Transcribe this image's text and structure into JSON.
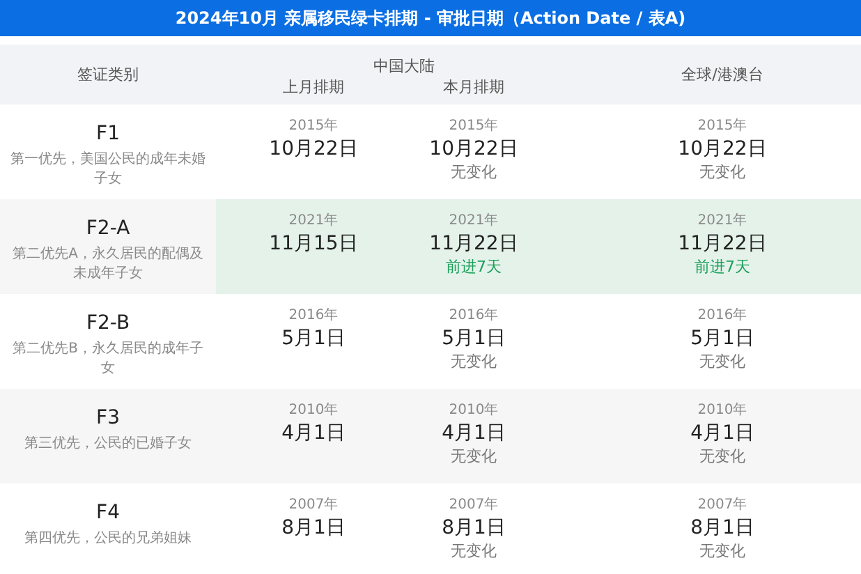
{
  "title": "2024年10月 亲属移民绿卡排期 - 审批日期（Action Date / 表A)",
  "header": {
    "category": "签证类别",
    "group": "中国大陆",
    "last_month": "上月排期",
    "this_month": "本月排期",
    "global": "全球/港澳台"
  },
  "rows": [
    {
      "code": "F1",
      "description": "第一优先，美国公民的成年未婚子女",
      "highlighted": false,
      "last": {
        "year": "2015年",
        "date": "10月22日"
      },
      "this": {
        "year": "2015年",
        "date": "10月22日",
        "change": {
          "text": "无变化",
          "kind": "none"
        }
      },
      "global": {
        "year": "2015年",
        "date": "10月22日",
        "change": {
          "text": "无变化",
          "kind": "none"
        }
      }
    },
    {
      "code": "F2-A",
      "description": "第二优先A，永久居民的配偶及未成年子女",
      "highlighted": true,
      "last": {
        "year": "2021年",
        "date": "11月15日"
      },
      "this": {
        "year": "2021年",
        "date": "11月22日",
        "change": {
          "text": "前进7天",
          "kind": "advance"
        }
      },
      "global": {
        "year": "2021年",
        "date": "11月22日",
        "change": {
          "text": "前进7天",
          "kind": "advance"
        }
      }
    },
    {
      "code": "F2-B",
      "description": "第二优先B，永久居民的成年子女",
      "highlighted": false,
      "last": {
        "year": "2016年",
        "date": "5月1日"
      },
      "this": {
        "year": "2016年",
        "date": "5月1日",
        "change": {
          "text": "无变化",
          "kind": "none"
        }
      },
      "global": {
        "year": "2016年",
        "date": "5月1日",
        "change": {
          "text": "无变化",
          "kind": "none"
        }
      }
    },
    {
      "code": "F3",
      "description": "第三优先，公民的已婚子女",
      "highlighted": false,
      "last": {
        "year": "2010年",
        "date": "4月1日"
      },
      "this": {
        "year": "2010年",
        "date": "4月1日",
        "change": {
          "text": "无变化",
          "kind": "none"
        }
      },
      "global": {
        "year": "2010年",
        "date": "4月1日",
        "change": {
          "text": "无变化",
          "kind": "none"
        }
      }
    },
    {
      "code": "F4",
      "description": "第四优先，公民的兄弟姐妹",
      "highlighted": false,
      "last": {
        "year": "2007年",
        "date": "8月1日"
      },
      "this": {
        "year": "2007年",
        "date": "8月1日",
        "change": {
          "text": "无变化",
          "kind": "none"
        }
      },
      "global": {
        "year": "2007年",
        "date": "8月1日",
        "change": {
          "text": "无变化",
          "kind": "none"
        }
      }
    }
  ]
}
